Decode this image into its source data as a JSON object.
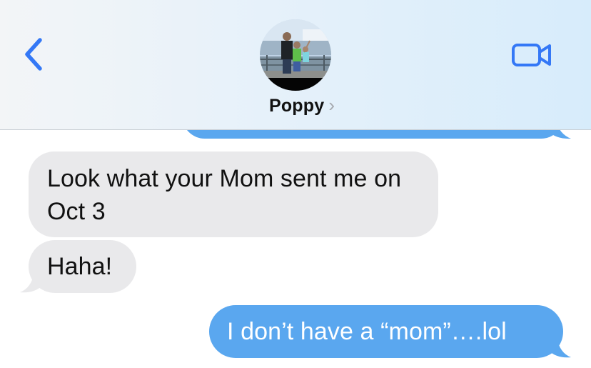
{
  "header": {
    "contact_name": "Poppy",
    "chevron": "›",
    "back_icon": "chevron-left-icon",
    "video_icon": "video-camera-icon",
    "accent_color": "#3478f6"
  },
  "messages": [
    {
      "direction": "received",
      "text": "Look what your Mom sent me on Oct 3"
    },
    {
      "direction": "received",
      "text": "Haha!"
    },
    {
      "direction": "sent",
      "text": "I don’t have a “mom”….lol"
    }
  ],
  "colors": {
    "sent_bubble": "#5aa7ef",
    "received_bubble": "#e9e9eb",
    "sent_text": "#ffffff",
    "received_text": "#111111"
  }
}
